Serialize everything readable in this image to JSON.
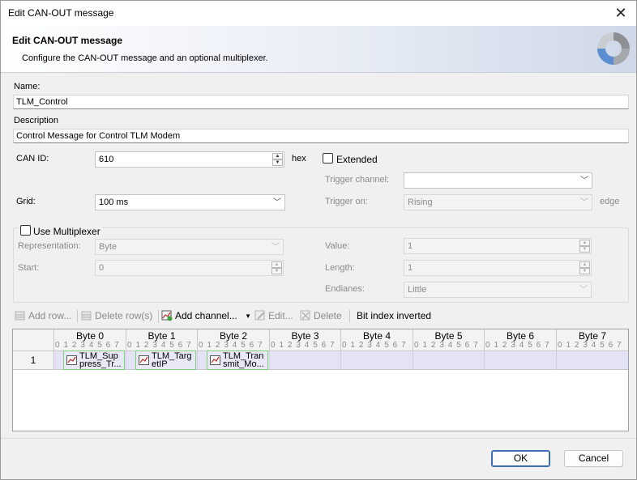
{
  "window": {
    "title": "Edit CAN-OUT message",
    "close_glyph": "✕"
  },
  "header": {
    "title": "Edit CAN-OUT message",
    "subtitle": "Configure the CAN-OUT message and an optional multiplexer."
  },
  "form": {
    "name_label": "Name:",
    "name_value": "TLM_Control",
    "description_label": "Description",
    "description_value": "Control Message for Control TLM Modem",
    "can_id_label": "CAN ID:",
    "can_id_value": "610",
    "can_id_unit": "hex",
    "extended_label": "Extended",
    "extended_checked": false,
    "trigger_channel_label": "Trigger channel:",
    "trigger_channel_value": "",
    "grid_label": "Grid:",
    "grid_value": "100 ms",
    "trigger_on_label": "Trigger on:",
    "trigger_on_value": "Rising",
    "trigger_on_suffix": "edge",
    "use_multiplexer_label": "Use Multiplexer",
    "use_multiplexer_checked": false,
    "representation_label": "Representation:",
    "representation_value": "Byte",
    "start_label": "Start:",
    "start_value": "0",
    "value_label": "Value:",
    "value_value": "1",
    "length_label": "Length:",
    "length_value": "1",
    "endianes_label": "Endianes:",
    "endianes_value": "Little"
  },
  "toolbar": {
    "add_row": "Add row...",
    "delete_rows": "Delete row(s)",
    "add_channel": "Add channel...",
    "edit": "Edit...",
    "delete": "Delete",
    "bit_index_inverted": "Bit index inverted"
  },
  "grid": {
    "bytes": [
      "Byte 0",
      "Byte 1",
      "Byte 2",
      "Byte 3",
      "Byte 4",
      "Byte 5",
      "Byte 6",
      "Byte 7"
    ],
    "bit_labels": "0 1 2 3 4 5 6 7",
    "rows": [
      "1"
    ],
    "signals": [
      {
        "line1": "TLM_Sup",
        "line2": "press_Tr..."
      },
      {
        "line1": "TLM_Targ",
        "line2": "etIP"
      },
      {
        "line1": "TLM_Tran",
        "line2": "smit_Mo..."
      }
    ]
  },
  "buttons": {
    "ok": "OK",
    "cancel": "Cancel"
  },
  "colors": {
    "row_highlight": "#e3e3f5",
    "signal_border": "#79d379",
    "default_button": "#3b6fb5"
  }
}
